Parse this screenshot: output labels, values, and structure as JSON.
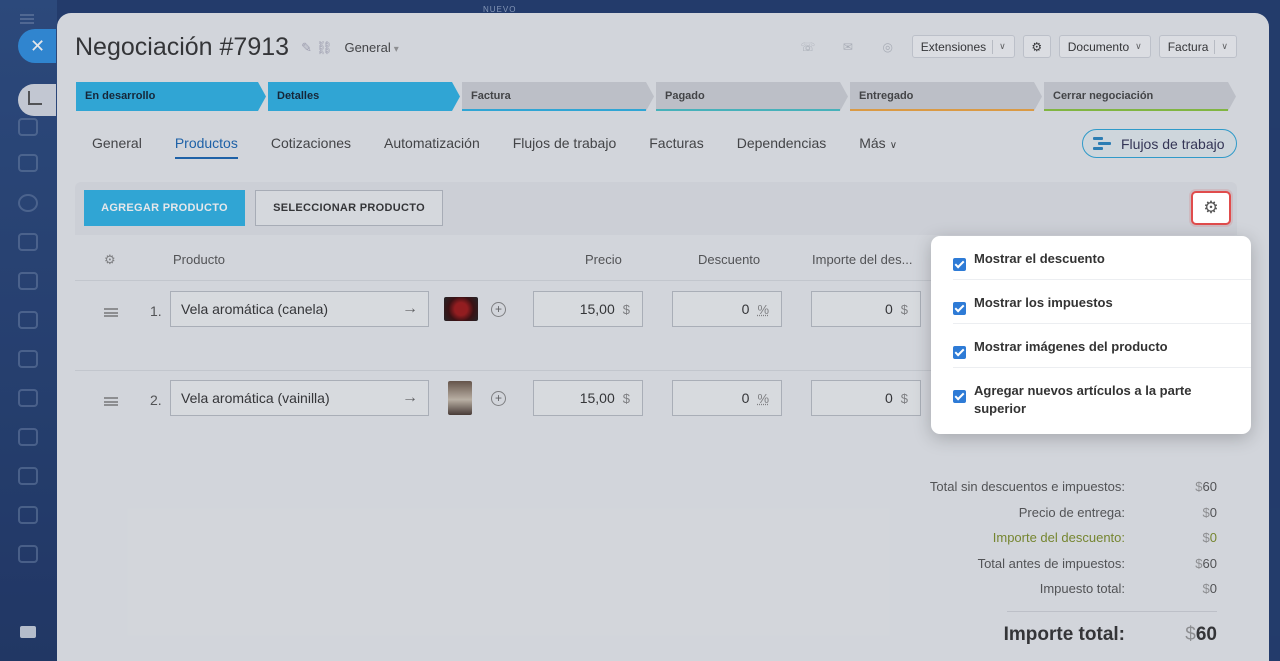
{
  "topbar": {
    "label": "NUEVO"
  },
  "deal": {
    "title": "Negociación #7913",
    "category": "General"
  },
  "toolbar": {
    "extensions": "Extensiones",
    "document": "Documento",
    "invoice": "Factura"
  },
  "stages": [
    {
      "label": "En desarrollo",
      "state": "active",
      "width": 190,
      "line": "#2fb4e6"
    },
    {
      "label": "Detalles",
      "state": "active",
      "width": 192,
      "line": "#2fb4e6"
    },
    {
      "label": "Factura",
      "state": "pending",
      "width": 192,
      "line": "#2fb4e6"
    },
    {
      "label": "Pagado",
      "state": "pending",
      "width": 192,
      "line": "#49c1c8"
    },
    {
      "label": "Entregado",
      "state": "pending",
      "width": 192,
      "line": "#f2a742"
    },
    {
      "label": "Cerrar negociación",
      "state": "pending",
      "width": 192,
      "line": "#8cc63f"
    }
  ],
  "tabs": [
    {
      "label": "General",
      "active": false
    },
    {
      "label": "Productos",
      "active": true
    },
    {
      "label": "Cotizaciones",
      "active": false
    },
    {
      "label": "Automatización",
      "active": false
    },
    {
      "label": "Flujos de trabajo",
      "active": false
    },
    {
      "label": "Facturas",
      "active": false
    },
    {
      "label": "Dependencias",
      "active": false
    },
    {
      "label": "Más",
      "active": false
    }
  ],
  "flows_button": "Flujos de trabajo",
  "products": {
    "add_label": "AGREGAR PRODUCTO",
    "select_label": "SELECCIONAR PRODUCTO",
    "columns": {
      "product": "Producto",
      "price": "Precio",
      "discount": "Descuento",
      "discount_amount": "Importe del des..."
    },
    "rows": [
      {
        "num": "1.",
        "name": "Vela aromática (canela)",
        "price": "15,00",
        "currency": "$",
        "discount": "0",
        "discount_unit": "%",
        "amount": "0",
        "amount_unit": "$"
      },
      {
        "num": "2.",
        "name": "Vela aromática (vainilla)",
        "price": "15,00",
        "currency": "$",
        "discount": "0",
        "discount_unit": "%",
        "amount": "0",
        "amount_unit": "$"
      }
    ]
  },
  "totals": [
    {
      "label": "Total sin descuentos e impuestos:",
      "cur": "$",
      "value": "60"
    },
    {
      "label": "Precio de entrega:",
      "cur": "$",
      "value": "0"
    },
    {
      "label": "Importe del descuento:",
      "cur": "$",
      "value": "0"
    },
    {
      "label": "Total antes de impuestos:",
      "cur": "$",
      "value": "60"
    },
    {
      "label": "Impuesto total:",
      "cur": "$",
      "value": "0"
    }
  ],
  "grand_total": {
    "label": "Importe total:",
    "cur": "$",
    "value": "60"
  },
  "settings_menu": [
    {
      "label": "Mostrar el descuento",
      "checked": true
    },
    {
      "label": "Mostrar los impuestos",
      "checked": true
    },
    {
      "label": "Mostrar imágenes del producto",
      "checked": true
    },
    {
      "label": "Agregar nuevos artículos a la parte superior",
      "checked": true
    }
  ],
  "colors": {
    "accent": "#2fb4e6",
    "link": "#1a66b3",
    "highlight": "#e04c4c",
    "checkbox": "#2e7bd6"
  }
}
